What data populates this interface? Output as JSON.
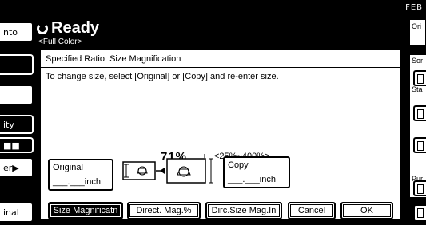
{
  "top_right_label": "FEB",
  "left_buttons": [
    {
      "label": "nto",
      "dark": false
    },
    {
      "label": "",
      "dark": true
    },
    {
      "label": "",
      "dark": false
    },
    {
      "label": "ity",
      "dark": true
    },
    {
      "label": "■■",
      "dark": true
    },
    {
      "label": "er▶",
      "dark": false
    },
    {
      "label": "inal",
      "dark": false
    }
  ],
  "header": {
    "title": "Ready",
    "color_mode": "<Full Color>"
  },
  "panel": {
    "title": "Specified Ratio: Size Magnification",
    "instruction": "To change size, select [Original] or [Copy] and re-enter size.",
    "ratio_value": "71%",
    "ratio_range": "<25%~400%>",
    "original": {
      "label": "Original",
      "value": "___.___inch"
    },
    "copy": {
      "label": "Copy",
      "value": "___.___inch"
    }
  },
  "buttons": {
    "size_magnification": "Size Magnificatn",
    "direct_mag": "Direct. Mag.%",
    "direct_size_mag": "Dirc.Size Mag.In",
    "cancel": "Cancel",
    "ok": "OK"
  },
  "right_column": {
    "top_label": "Ori",
    "sort_label": "Sor",
    "stack_label": "Sta",
    "punch_label": "Pur"
  }
}
